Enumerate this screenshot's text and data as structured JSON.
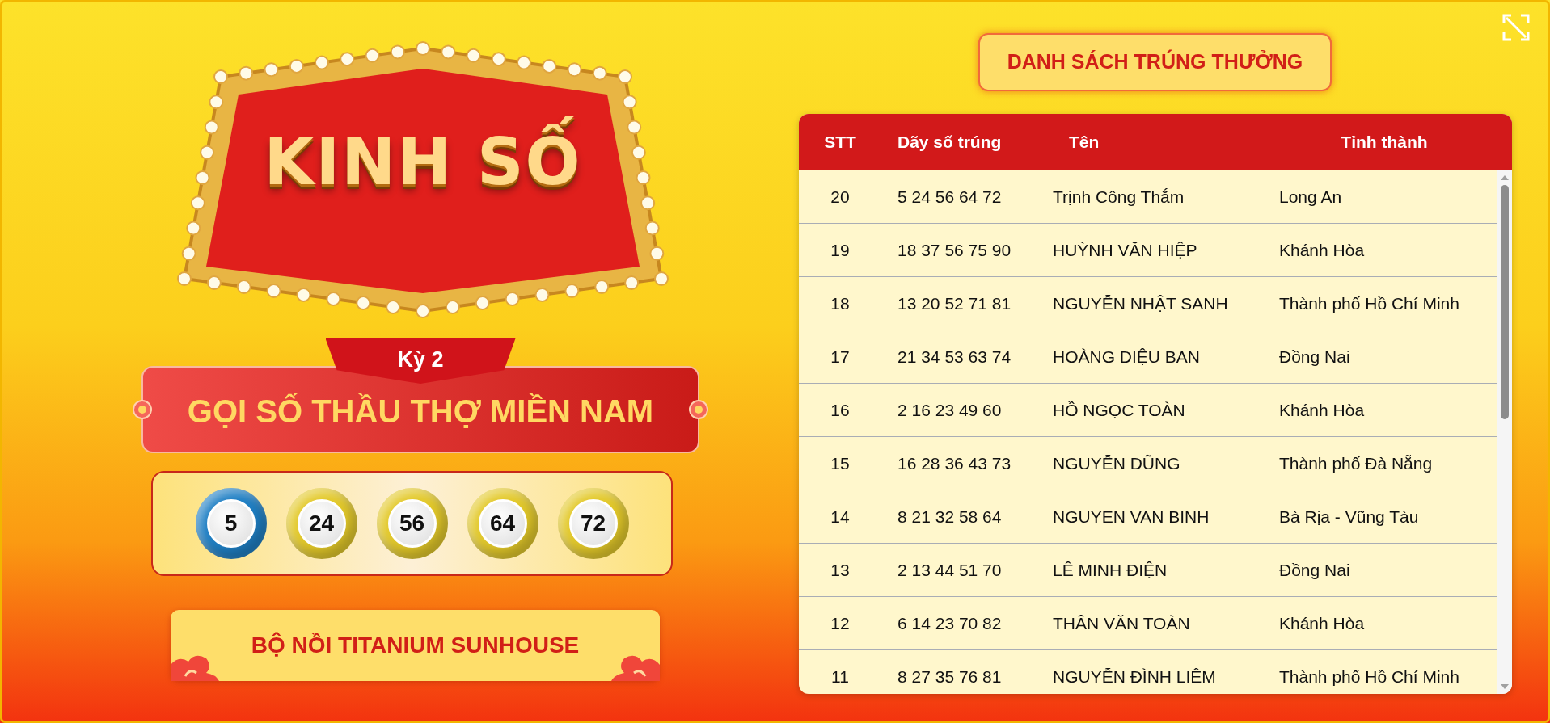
{
  "logo": {
    "text": "KINH SỐ"
  },
  "period": "Kỳ 2",
  "title": "GỌI SỐ THẦU THỢ MIỀN NAM",
  "balls": [
    {
      "number": "5",
      "color": "#1f7fc4"
    },
    {
      "number": "24",
      "color": "#e3c92a"
    },
    {
      "number": "56",
      "color": "#e3c92a"
    },
    {
      "number": "64",
      "color": "#e3c92a"
    },
    {
      "number": "72",
      "color": "#e3c92a"
    }
  ],
  "prize": "BỘ NỒI TITANIUM SUNHOUSE",
  "winners_button": "DANH SÁCH TRÚNG THƯỞNG",
  "table": {
    "columns": [
      "STT",
      "Dãy số trúng",
      "Tên",
      "Tỉnh thành"
    ],
    "rows": [
      [
        "20",
        "5 24 56 64 72",
        "Trịnh Công Thắm",
        "Long An"
      ],
      [
        "19",
        "18 37 56 75 90",
        "HUỲNH VĂN HIỆP",
        "Khánh Hòa"
      ],
      [
        "18",
        "13 20 52 71 81",
        "NGUYỄN NHẬT SANH",
        "Thành phố Hồ Chí Minh"
      ],
      [
        "17",
        "21 34 53 63 74",
        "HOÀNG DIỆU BAN",
        "Đồng Nai"
      ],
      [
        "16",
        "2 16 23 49 60",
        "HỒ NGỌC TOÀN",
        "Khánh Hòa"
      ],
      [
        "15",
        "16 28 36 43 73",
        "NGUYỄN DŨNG",
        "Thành phố Đà Nẵng"
      ],
      [
        "14",
        "8 21 32 58 64",
        "NGUYEN VAN BINH",
        "Bà Rịa - Vũng Tàu"
      ],
      [
        "13",
        "2 13 44 51 70",
        "LÊ MINH ĐIỆN",
        "Đồng Nai"
      ],
      [
        "12",
        "6 14 23 70 82",
        "THÂN VĂN TOÀN",
        "Khánh Hòa"
      ],
      [
        "11",
        "8 27 35 76 81",
        "NGUYỄN ĐÌNH LIÊM",
        "Thành phố Hồ Chí Minh"
      ]
    ]
  }
}
